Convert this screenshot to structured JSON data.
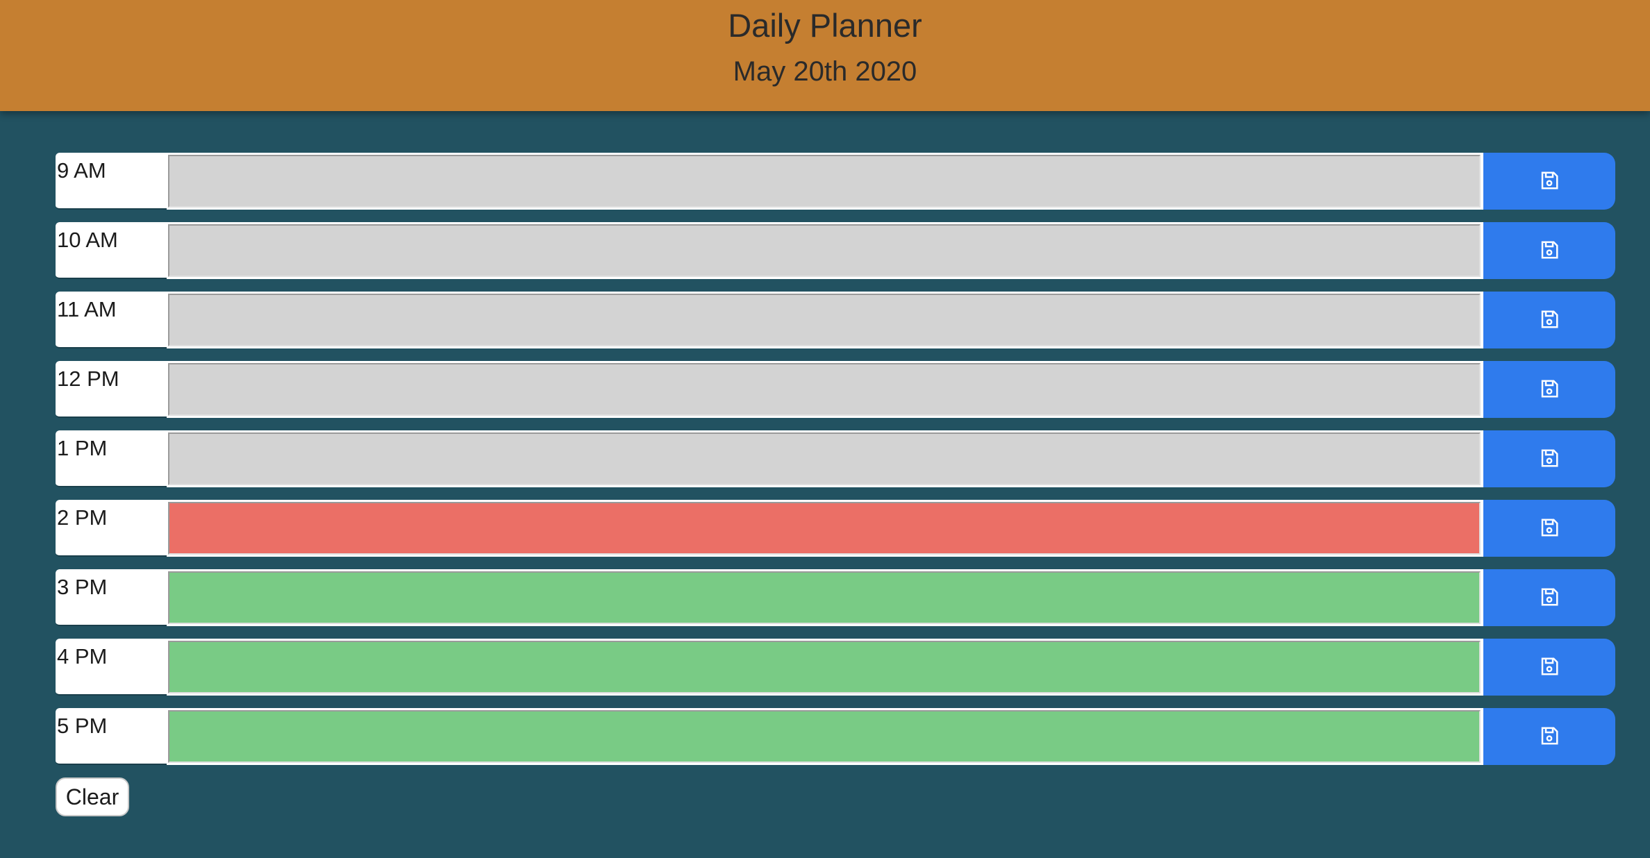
{
  "header": {
    "title": "Daily Planner",
    "date": "May 20th 2020",
    "background_color": "#c57f31"
  },
  "page": {
    "background_color": "#225261"
  },
  "status_colors": {
    "past": "#d3d3d3",
    "present": "#eb6f66",
    "future": "#79cb85",
    "save_button": "#2f7bed"
  },
  "time_blocks": [
    {
      "hour": "9 AM",
      "status": "past",
      "text": ""
    },
    {
      "hour": "10 AM",
      "status": "past",
      "text": ""
    },
    {
      "hour": "11 AM",
      "status": "past",
      "text": ""
    },
    {
      "hour": "12 PM",
      "status": "past",
      "text": ""
    },
    {
      "hour": "1 PM",
      "status": "past",
      "text": ""
    },
    {
      "hour": "2 PM",
      "status": "present",
      "text": ""
    },
    {
      "hour": "3 PM",
      "status": "future",
      "text": ""
    },
    {
      "hour": "4 PM",
      "status": "future",
      "text": ""
    },
    {
      "hour": "5 PM",
      "status": "future",
      "text": ""
    }
  ],
  "save_icon": "floppy-disk-icon",
  "clear_label": "Clear"
}
